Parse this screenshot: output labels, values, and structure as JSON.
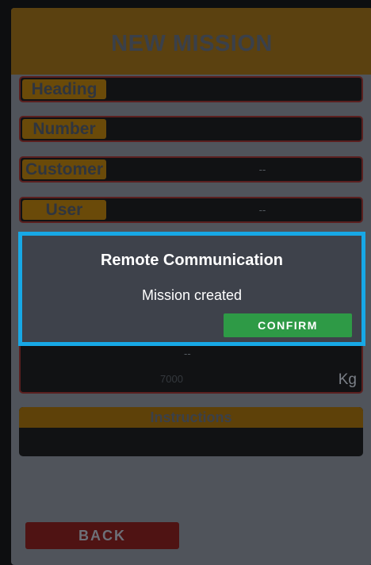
{
  "header": {
    "title": "NEW MISSION"
  },
  "form": {
    "fields": [
      {
        "label": "Heading",
        "value": ""
      },
      {
        "label": "Number",
        "value": ""
      },
      {
        "label": "Customer",
        "value": "--"
      },
      {
        "label": "User",
        "value": "--"
      }
    ],
    "quantity": {
      "dash": "--",
      "value": "7000",
      "unit": "Kg"
    },
    "instructions": {
      "label": "Instructions",
      "value": ""
    }
  },
  "footer": {
    "back_label": "BACK"
  },
  "dialog": {
    "title": "Remote Communication",
    "message": "Mission created",
    "confirm_label": "CONFIRM",
    "accent_color": "#17a8e6",
    "confirm_color": "#2e9a46"
  }
}
